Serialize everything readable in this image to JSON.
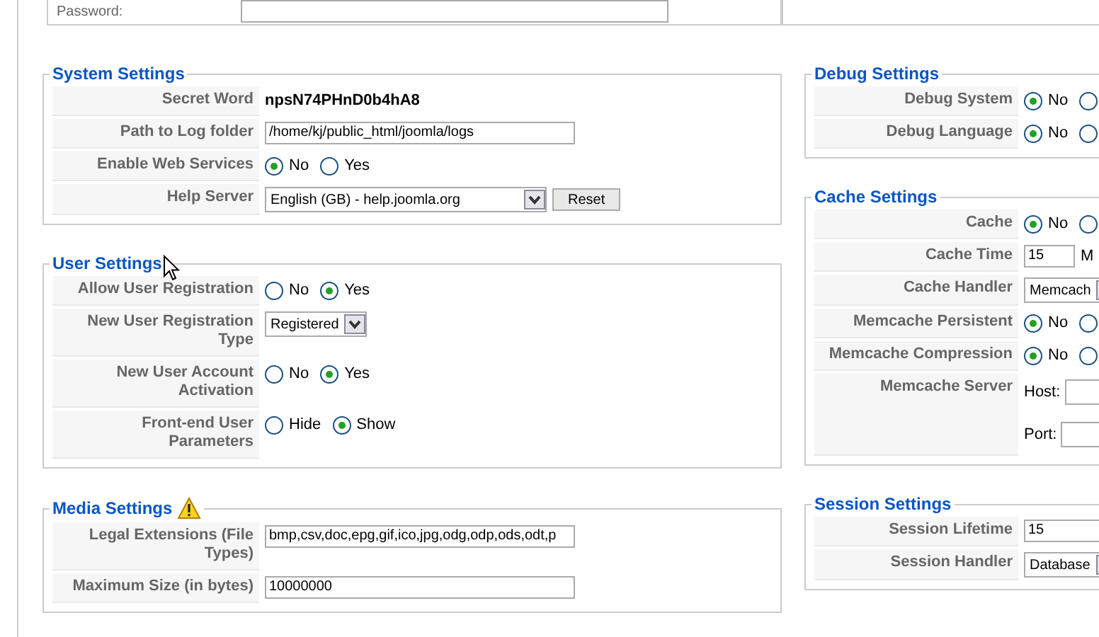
{
  "top_section": {
    "rows": [
      {
        "label": "Password:",
        "kind": "input"
      }
    ]
  },
  "left_sections": [
    {
      "title": "System Settings",
      "rows": [
        {
          "label": "Secret Word",
          "kind": "text",
          "value": "npsN74PHnD0b4hA8"
        },
        {
          "label": "Path to Log folder",
          "kind": "input",
          "value": "/home/kj/public_html/joomla/logs"
        },
        {
          "label": "Enable Web Services",
          "kind": "radio",
          "options": [
            {
              "label": "No",
              "selected": true
            },
            {
              "label": "Yes",
              "selected": false
            }
          ]
        },
        {
          "label": "Help Server",
          "kind": "select",
          "value": "English (GB) - help.joomla.org",
          "button": "Reset"
        }
      ]
    },
    {
      "title": "User Settings",
      "rows": [
        {
          "label": "Allow User Registration",
          "kind": "radio",
          "options": [
            {
              "label": "No",
              "selected": false
            },
            {
              "label": "Yes",
              "selected": true
            }
          ]
        },
        {
          "label": "New User Registration Type",
          "kind": "select_small",
          "value": "Registered"
        },
        {
          "label": "New User Account Activation",
          "kind": "radio",
          "options": [
            {
              "label": "No",
              "selected": false
            },
            {
              "label": "Yes",
              "selected": true
            }
          ]
        },
        {
          "label": "Front-end User Parameters",
          "kind": "radio",
          "options": [
            {
              "label": "Hide",
              "selected": false
            },
            {
              "label": "Show",
              "selected": true
            }
          ]
        }
      ]
    },
    {
      "title": "Media Settings",
      "warning": true,
      "rows": [
        {
          "label": "Legal Extensions (File Types)",
          "kind": "input",
          "value": "bmp,csv,doc,epg,gif,ico,jpg,odg,odp,ods,odt,p"
        },
        {
          "label": "Maximum Size (in bytes)",
          "kind": "input",
          "value": "10000000"
        }
      ]
    }
  ],
  "right_sections": [
    {
      "title": "Debug Settings",
      "rows": [
        {
          "label": "Debug System",
          "kind": "radio",
          "options": [
            {
              "label": "No",
              "selected": true
            },
            {
              "selected": false
            }
          ]
        },
        {
          "label": "Debug Language",
          "kind": "radio",
          "options": [
            {
              "label": "No",
              "selected": true
            },
            {
              "selected": false
            }
          ]
        }
      ]
    },
    {
      "title": "Cache Settings",
      "rows": [
        {
          "label": "Cache",
          "kind": "radio",
          "options": [
            {
              "label": "No",
              "selected": true
            },
            {
              "selected": false
            }
          ]
        },
        {
          "label": "Cache Time",
          "kind": "input_unit",
          "value": "15",
          "unit": "M"
        },
        {
          "label": "Cache Handler",
          "kind": "select",
          "value": "Memcach"
        },
        {
          "label": "Memcache Persistent",
          "kind": "radio",
          "options": [
            {
              "label": "No",
              "selected": true
            },
            {
              "selected": false
            }
          ]
        },
        {
          "label": "Memcache Compression",
          "kind": "radio",
          "options": [
            {
              "label": "No",
              "selected": true
            },
            {
              "selected": false
            }
          ]
        },
        {
          "label": "Memcache Server",
          "kind": "host_port",
          "fields": [
            {
              "label": "Host:"
            },
            {
              "label": "Port:"
            }
          ]
        }
      ]
    },
    {
      "title": "Session Settings",
      "rows": [
        {
          "label": "Session Lifetime",
          "kind": "input",
          "value": "15"
        },
        {
          "label": "Session Handler",
          "kind": "select",
          "value": "Database"
        }
      ]
    }
  ]
}
